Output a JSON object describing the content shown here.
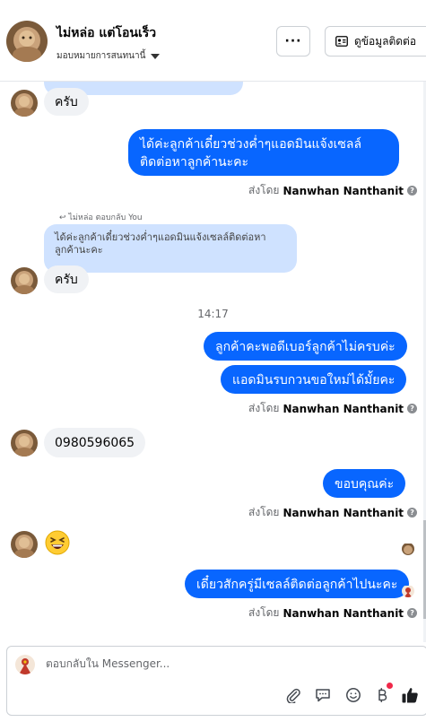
{
  "header": {
    "contact_name": "ไม่หล่อ แต่โอนเร็ว",
    "assign_label": "มอบหมายการสนทนานี้",
    "more_label": "···",
    "contact_info_label": "ดูข้อมูลติดต่อ"
  },
  "messages": {
    "in_1": "ครับ",
    "out_1": "ได้ค่ะลูกค้าเดี๋ยวช่วงค่ำๆแอดมินแจ้งเซลล์ติดต่อหาลูกค้านะคะ",
    "reply_meta": "ไม่หล่อ ตอบกลับ You",
    "quoted_text": "ได้ค่ะลูกค้าเดี๋ยวช่วงค่ำๆแอดมินแจ้งเซลล์ติดต่อหาลูกค้านะคะ",
    "in_2": "ครับ",
    "timestamp": "14:17",
    "out_2": "ลูกค้าคะพอดีเบอร์ลูกค้าไม่ครบค่ะ",
    "out_3": "แอดมินรบกวนขอใหม่ได้มั้ยคะ",
    "in_3": "0980596065",
    "out_4": "ขอบคุณค่ะ",
    "in_4_emoji": "😆",
    "out_5": "เดี๋ยวสักครู่มีเซลล์ติดต่อลูกค้าไปนะคะ"
  },
  "sent_by": {
    "prefix": "ส่งโดย",
    "name": "Nanwhan Nanthanit",
    "info": "?"
  },
  "composer": {
    "placeholder": "ตอบกลับใน Messenger..."
  },
  "colors": {
    "accent": "#0866ff",
    "incoming_bubble": "#f0f2f5",
    "quoted_bubble": "#cfe2ff",
    "notification": "#f02849"
  },
  "icons": {
    "attachment": "paperclip-icon",
    "saved_replies": "chat-bubble-icon",
    "emoji": "smiley-icon",
    "payment": "baht-icon",
    "like": "thumbs-up-icon"
  }
}
